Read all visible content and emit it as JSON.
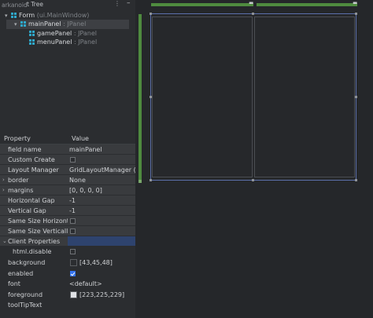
{
  "tree": {
    "title_ghost": "arkanoid",
    "title": "t Tree",
    "items": [
      {
        "label": "Form",
        "type": "(ui.MainWindow)",
        "arrow": "▾"
      },
      {
        "label": "mainPanel",
        "type": ": JPanel",
        "arrow": "▾"
      },
      {
        "label": "gamePanel",
        "type": ": JPanel",
        "arrow": ""
      },
      {
        "label": "menuPanel",
        "type": ": JPanel",
        "arrow": ""
      }
    ]
  },
  "properties": {
    "header": {
      "property": "Property",
      "value": "Value"
    },
    "rows": [
      {
        "name": "field name",
        "value": "mainPanel"
      },
      {
        "name": "Custom Create",
        "value": ""
      },
      {
        "name": "Layout Manager",
        "value": "GridLayoutManager (I..."
      },
      {
        "name": "border",
        "value": "None"
      },
      {
        "name": "margins",
        "value": "[0, 0, 0, 0]"
      },
      {
        "name": "Horizontal Gap",
        "value": "-1"
      },
      {
        "name": "Vertical Gap",
        "value": "-1"
      },
      {
        "name": "Same Size Horizontally",
        "value": ""
      },
      {
        "name": "Same Size Vertically",
        "value": ""
      },
      {
        "name": "Client Properties",
        "value": ""
      },
      {
        "name": "html.disable",
        "value": ""
      },
      {
        "name": "background",
        "value": "[43,45,48]"
      },
      {
        "name": "enabled",
        "value": ""
      },
      {
        "name": "font",
        "value": "<default>"
      },
      {
        "name": "foreground",
        "value": "[223,225,229]"
      },
      {
        "name": "toolTipText",
        "value": ""
      }
    ],
    "checkbox_states": {
      "custom_create": false,
      "same_size_h": false,
      "same_size_v": false,
      "html_disable": false,
      "enabled": true
    },
    "colors": {
      "background_swatch": "#2b2d30",
      "foreground_swatch": "#dfe1e5",
      "selection": "#2e436e"
    }
  },
  "icons": {
    "form": "component-icon",
    "panel": "component-icon",
    "expand": "chevron-right-icon",
    "collapse": "chevron-down-icon"
  },
  "colors": {
    "grid_bar": "#4f8b3f",
    "panel_border": "#5b6faa",
    "background": "#2b2d30"
  }
}
